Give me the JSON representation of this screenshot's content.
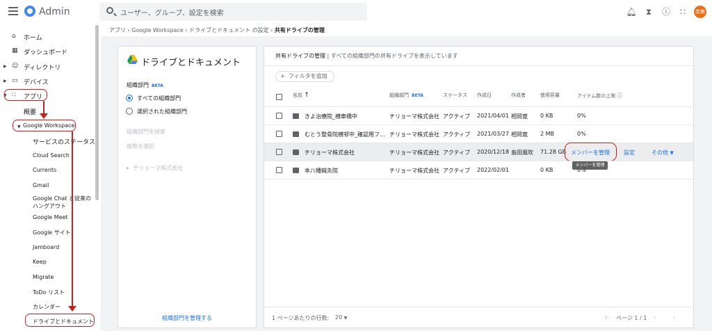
{
  "header": {
    "brand": "Admin",
    "search_placeholder": "ユーザー、グループ、設定を検索",
    "avatar_text": "奈美"
  },
  "sidebar": {
    "items": [
      {
        "label": "ホーム",
        "icon": "home-icon"
      },
      {
        "label": "ダッシュボード",
        "icon": "dashboard-icon"
      },
      {
        "label": "ディレクトリ",
        "icon": "person-icon"
      },
      {
        "label": "デバイス",
        "icon": "devices-icon"
      },
      {
        "label": "アプリ",
        "icon": "apps-grid-icon"
      }
    ],
    "overview": "概要",
    "section": "Google Workspace",
    "sub_items": [
      "サービスのステータス",
      "Cloud Search",
      "Currents",
      "Gmail",
      "Google Chat と従来のハングアウト",
      "Google Meet",
      "Google サイト",
      "Jamboard",
      "Keep",
      "Migrate",
      "ToDo リスト",
      "カレンダー",
      "ドライブとドキュメント"
    ]
  },
  "breadcrumb": {
    "parts": [
      "アプリ",
      "Google Workspace",
      "ドライブとドキュメント の設定"
    ],
    "current": "共有ドライブの管理"
  },
  "left_panel": {
    "title": "ドライブとドキュメント",
    "org_label": "組織部門",
    "beta": "BETA",
    "radio_all": "すべての組織部門",
    "radio_selected": "選択された組織部門",
    "search_ph": "組織部門を検索",
    "multi_select": "複数を選択",
    "org_name": "チリョーマ株式会社",
    "manage_link": "組織部門を管理する"
  },
  "main": {
    "head_title": "共有ドライブの管理",
    "head_sub": " | すべての組織部門の共有ドライブを表示しています",
    "filter": "フィルタを追加",
    "columns": {
      "name": "名前",
      "org": "組織部門",
      "org_beta": "BETA",
      "status": "ステータス",
      "created": "作成日",
      "creator": "作成者",
      "storage": "使用容量",
      "limit": "アイテム数の上限"
    },
    "rows": [
      {
        "name": "きよ治療院_横車橋中",
        "org": "チリョーマ株式会社",
        "status": "アクティブ",
        "created": "2021/04/01",
        "creator": "相岡寛",
        "storage": "0 KB",
        "limit": "0%"
      },
      {
        "name": "むとう整骨院横邨中_確認用フ...",
        "org": "チリョーマ株式会社",
        "status": "アクティブ",
        "created": "2021/03/27",
        "creator": "相岡寛",
        "storage": "2 MB",
        "limit": "0%"
      },
      {
        "name": "チリョーマ株式会社",
        "org": "チリョーマ株式会社",
        "status": "アクティブ",
        "created": "2020/12/18",
        "creator": "島田風吹",
        "storage": "71.28 GB",
        "limit": ""
      },
      {
        "name": "本八幡鍼灸院",
        "org": "チリョーマ株式会社",
        "status": "アクティブ",
        "created": "2022/02/01",
        "creator": "",
        "storage": "0 KB",
        "limit": "0%"
      }
    ],
    "row_actions": {
      "manage": "メンバーを管理",
      "settings": "設定",
      "more": "その他"
    },
    "tooltip": "メンバーを管理",
    "footer": {
      "rows_per_page_label": "1 ページあたりの行数:",
      "rows_per_page": "20",
      "pagination": "ページ 1 / 1"
    }
  }
}
